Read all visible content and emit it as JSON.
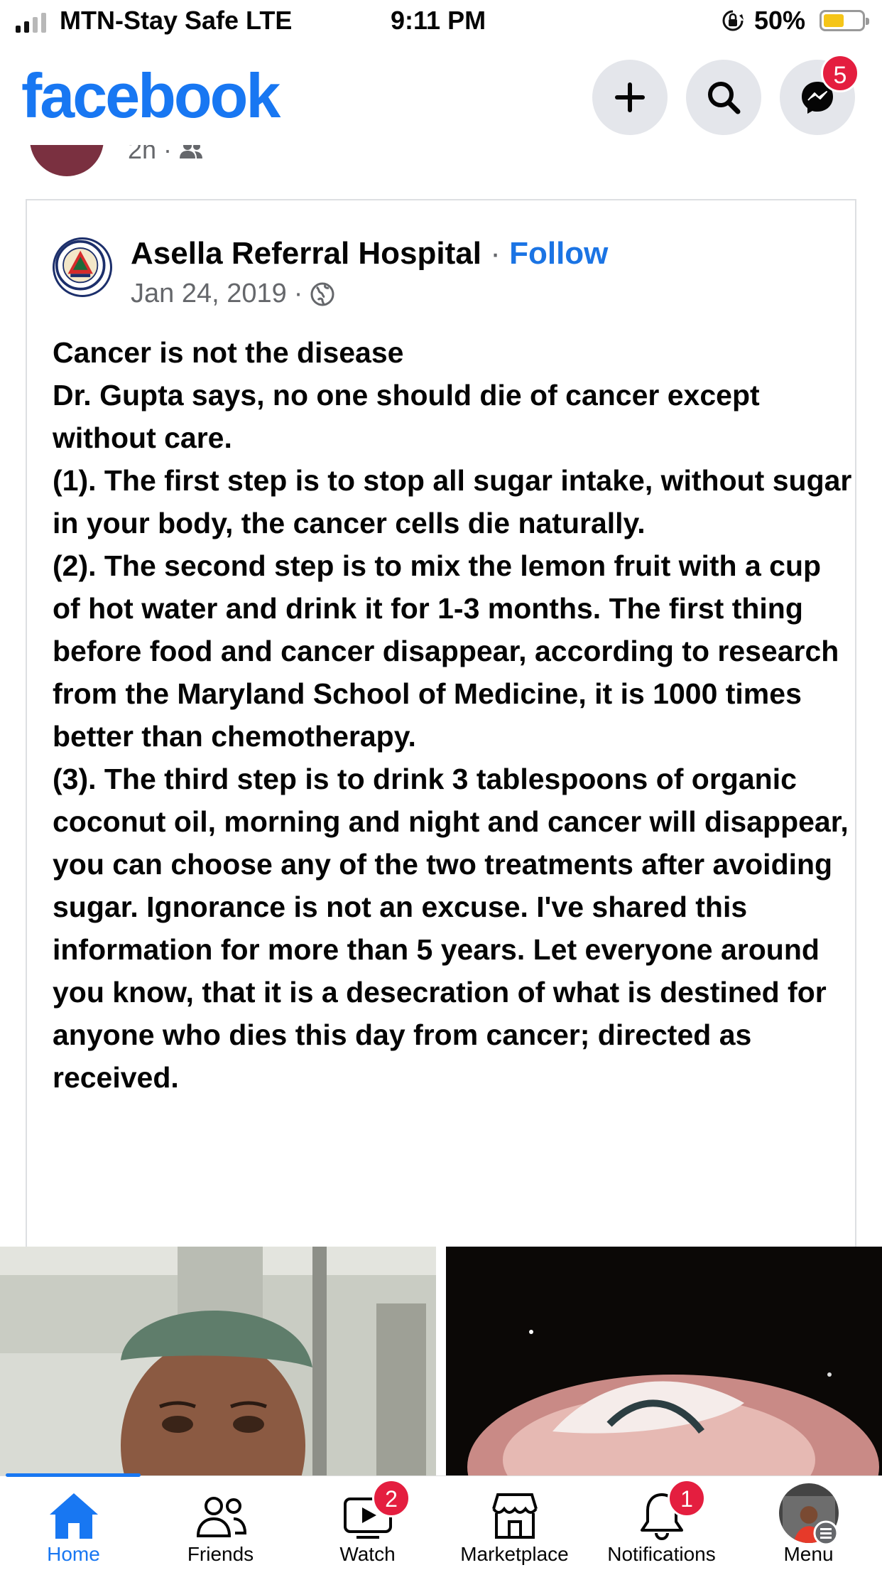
{
  "status_bar": {
    "carrier": "MTN-Stay Safe  LTE",
    "time": "9:11 PM",
    "battery": "50%",
    "battery_level": 0.5
  },
  "header": {
    "logo": "facebook",
    "buttons": [
      "plus-icon",
      "search-icon",
      "messenger-icon"
    ],
    "messenger_badge": "5",
    "brand_color": "#1877f2"
  },
  "previous_post": {
    "time": "2h"
  },
  "shared_post": {
    "page_name": "Asella Referral Hospital",
    "separator": "·",
    "follow": "Follow",
    "date": "Jan 24, 2019",
    "body": [
      "Cancer is not the disease",
      "Dr. Gupta says, no one should die of cancer except without care.",
      "(1). The first step is to stop all sugar intake, without sugar in your body, the cancer cells die naturally.",
      "(2). The second step is to mix the lemon fruit with a cup of hot water and drink it for 1-3 months. The first thing before food and cancer disappear, according to research from the Maryland School of Medicine, it is 1000 times better than chemotherapy.",
      "(3). The third step is to drink 3 tablespoons of organic coconut oil, morning and night and cancer will disappear, you can choose any of the two treatments after avoiding sugar. Ignorance is not an excuse. I've shared this information for more than 5 years. Let everyone around you know, that it is a desecration of what is destined for anyone who dies this day from cancer; directed as received."
    ]
  },
  "bottom_nav": {
    "items": [
      {
        "label": "Home",
        "icon": "home-icon",
        "active": true
      },
      {
        "label": "Friends",
        "icon": "friends-icon"
      },
      {
        "label": "Watch",
        "icon": "watch-icon",
        "badge": "2"
      },
      {
        "label": "Marketplace",
        "icon": "marketplace-icon"
      },
      {
        "label": "Notifications",
        "icon": "bell-icon",
        "badge": "1"
      },
      {
        "label": "Menu",
        "icon": "menu-avatar"
      }
    ]
  }
}
